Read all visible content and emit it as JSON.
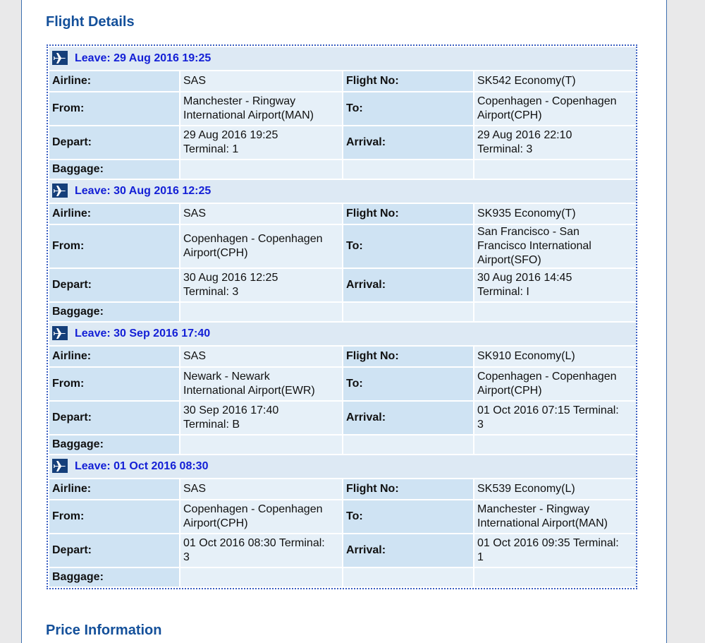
{
  "headings": {
    "flight_details": "Flight Details",
    "price_information": "Price Information"
  },
  "labels": {
    "airline": "Airline:",
    "flight_no": "Flight No:",
    "from": "From:",
    "to": "To:",
    "depart": "Depart:",
    "arrival": "Arrival:",
    "baggage": "Baggage:"
  },
  "icon": "airplane-icon",
  "segments": [
    {
      "leave": "Leave: 29 Aug 2016 19:25",
      "airline": "SAS",
      "flight_no": "SK542  Economy(T)",
      "from_1": "Manchester - Ringway",
      "from_2": "International Airport(MAN)",
      "from_3": "",
      "to_1": "Copenhagen - Copenhagen",
      "to_2": "Airport(CPH)",
      "to_3": "",
      "depart_1": "29 Aug 2016 19:25",
      "depart_2": "Terminal: 1",
      "arrival_1": "29 Aug 2016 22:10",
      "arrival_2": "Terminal: 3",
      "baggage": "",
      "baggage_2": ""
    },
    {
      "leave": "Leave: 30 Aug 2016 12:25",
      "airline": "SAS",
      "flight_no": "SK935  Economy(T)",
      "from_1": "Copenhagen - Copenhagen",
      "from_2": "Airport(CPH)",
      "from_3": "",
      "to_1": "San Francisco - San",
      "to_2": "Francisco International",
      "to_3": "Airport(SFO)",
      "depart_1": "30 Aug 2016 12:25",
      "depart_2": "Terminal: 3",
      "arrival_1": "30 Aug 2016 14:45",
      "arrival_2": "Terminal: I",
      "baggage": "",
      "baggage_2": ""
    },
    {
      "leave": "Leave: 30 Sep 2016 17:40",
      "airline": "SAS",
      "flight_no": "SK910  Economy(L)",
      "from_1": "Newark - Newark",
      "from_2": "International Airport(EWR)",
      "from_3": "",
      "to_1": "Copenhagen - Copenhagen",
      "to_2": "Airport(CPH)",
      "to_3": "",
      "depart_1": "30 Sep 2016 17:40",
      "depart_2": "Terminal: B",
      "arrival_1": "01 Oct 2016 07:15 Terminal:",
      "arrival_2": "3",
      "baggage": "",
      "baggage_2": ""
    },
    {
      "leave": "Leave: 01 Oct 2016 08:30",
      "airline": "SAS",
      "flight_no": "SK539  Economy(L)",
      "from_1": "Copenhagen - Copenhagen",
      "from_2": "Airport(CPH)",
      "from_3": "",
      "to_1": "Manchester - Ringway",
      "to_2": "International Airport(MAN)",
      "to_3": "",
      "depart_1": "01 Oct 2016 08:30 Terminal:",
      "depart_2": "3",
      "arrival_1": "01 Oct 2016 09:35 Terminal:",
      "arrival_2": "1",
      "baggage": "",
      "baggage_2": ""
    }
  ]
}
